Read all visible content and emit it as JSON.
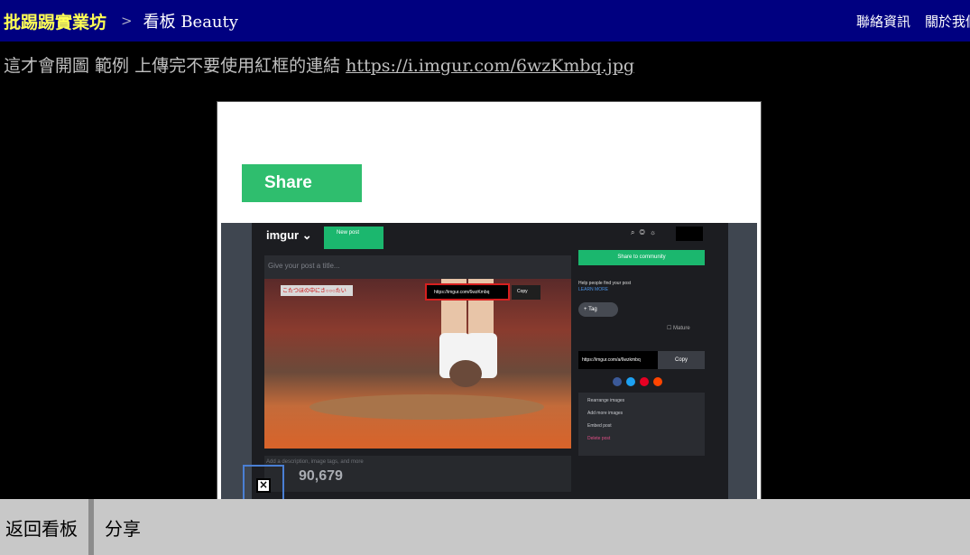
{
  "header": {
    "site_name": "批踢踢實業坊",
    "separator": ">",
    "board": "看板 Beauty",
    "links": [
      "聯絡資訊",
      "關於我們"
    ]
  },
  "post": {
    "text": "這才會開圖 範例 上傳完不要使用紅框的連結",
    "link": "https://i.imgur.com/6wzKmbq.jpg"
  },
  "embedded_image": {
    "share_button": "Share",
    "imgur": {
      "logo": "imgur",
      "new_post": "New post",
      "title_placeholder": "Give your post a title...",
      "photo_caption": "こたつほの中にさ○○○たい",
      "url_popup": "https://imgur.com/6wzKmbq",
      "copy_popup": "Copy",
      "description_placeholder": "Add a description, image tags, and more",
      "views": "90,679",
      "share_community": "Share to community",
      "help_text": "Help people find your post",
      "learn_more": "LEARN MORE",
      "tag_label": "+ Tag",
      "mature_label": "Mature",
      "link_field": "https://imgur.com/a/6wzkmbq",
      "link_copy": "Copy",
      "options": [
        "Rearrange images",
        "Add more images",
        "Embed post",
        "Delete post"
      ],
      "social_colors": [
        "#3b5998",
        "#1da1f2",
        "#e60023",
        "#ff4500"
      ]
    }
  },
  "footer": {
    "back_label": "返回看板",
    "share_label": "分享"
  }
}
